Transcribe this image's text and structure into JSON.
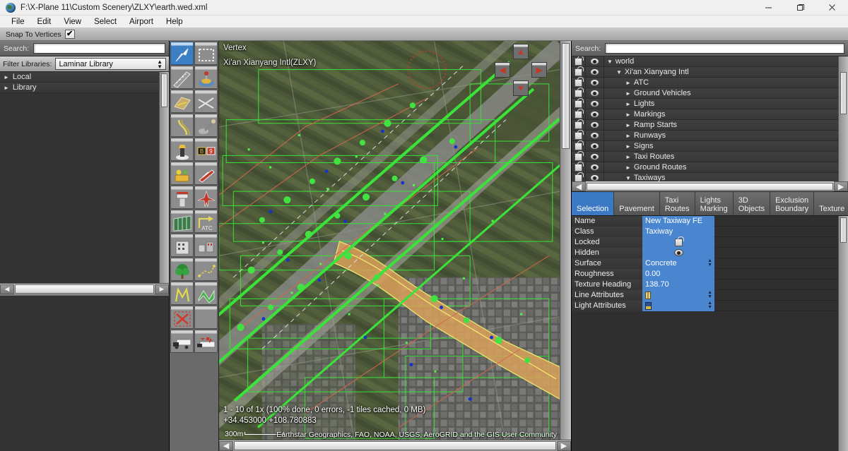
{
  "window": {
    "title": "F:\\X-Plane 11\\Custom Scenery\\ZLXY\\earth.wed.xml",
    "minimize": "—",
    "maximize": "❐",
    "close": "×"
  },
  "menubar": {
    "items": [
      "File",
      "Edit",
      "View",
      "Select",
      "Airport",
      "Help"
    ]
  },
  "toolstrip": {
    "snap_label": "Snap To Vertices",
    "snap_checked": "✔"
  },
  "left_panel": {
    "search_label": "Search:",
    "search_value": "",
    "filter_label": "Filter Libraries:",
    "filter_value": "Laminar Library",
    "tree": [
      {
        "label": "Local",
        "arrow": "►"
      },
      {
        "label": "Library",
        "arrow": "►"
      }
    ],
    "scroll_left": "◄",
    "scroll_right": "►"
  },
  "palette": {
    "tools": [
      {
        "name": "arrow-select-tool",
        "glyph": "↖",
        "selected": true
      },
      {
        "name": "marquee-select-tool",
        "glyph": "⬚",
        "selected": false
      },
      {
        "name": "runway-tool",
        "glyph": "╱",
        "selected": false
      },
      {
        "name": "helipad-tool",
        "glyph": "⊕",
        "selected": false
      },
      {
        "name": "taxiway-tool",
        "glyph": "▱",
        "selected": false
      },
      {
        "name": "sealane-tool",
        "glyph": "✕",
        "selected": false
      },
      {
        "name": "taxiline-tool",
        "glyph": "⤵",
        "selected": false
      },
      {
        "name": "hole-tool",
        "glyph": "⛏",
        "selected": false
      },
      {
        "name": "light-fixture-tool",
        "glyph": "⚙",
        "selected": false
      },
      {
        "name": "sign-tool",
        "glyph": "▭",
        "selected": false
      },
      {
        "name": "ramp-start-tool",
        "glyph": "✈",
        "selected": false
      },
      {
        "name": "windsock-tool",
        "glyph": "➤",
        "selected": false
      },
      {
        "name": "tower-viewpoint-tool",
        "glyph": "♜",
        "selected": false
      },
      {
        "name": "airplane-object-tool",
        "glyph": "✈",
        "selected": false
      },
      {
        "name": "facade-tool",
        "glyph": "▤",
        "selected": false
      },
      {
        "name": "atc-flow-tool",
        "glyph": "ATC",
        "selected": false
      },
      {
        "name": "building-tool",
        "glyph": "▦",
        "selected": false
      },
      {
        "name": "object-tool",
        "glyph": "▣",
        "selected": false
      },
      {
        "name": "forest-tool",
        "glyph": "♣",
        "selected": false
      },
      {
        "name": "line-string-tool",
        "glyph": "∴",
        "selected": false
      },
      {
        "name": "polygon-tool",
        "glyph": "ⱼ",
        "selected": false
      },
      {
        "name": "draped-polygon-tool",
        "glyph": "▰",
        "selected": false
      },
      {
        "name": "exclusion-zone-tool",
        "glyph": "✕",
        "selected": false
      },
      {
        "name": "empty-tool",
        "glyph": "",
        "selected": false
      },
      {
        "name": "truck-parking-tool",
        "glyph": "⛟",
        "selected": false
      },
      {
        "name": "truck-destination-tool",
        "glyph": "⇄",
        "selected": false
      }
    ]
  },
  "map": {
    "mode_label": "Vertex",
    "airport_label": "Xi'an Xianyang Intl(ZLXY)",
    "status_line": "1 - 10 of 1x (100% done, 0 errors, -1 tiles cached, 0 MB)",
    "coordinates": "+34.453000 +108.780883",
    "scale_label": "300m",
    "attribution": "Earthstar Geographics, FAO, NOAA, USGS, AeroGRID and the GIS User Community",
    "nav_buttons": [
      "pan-up",
      "pan-left",
      "pan-right",
      "pan-down"
    ]
  },
  "right_panel": {
    "search_label": "Search:",
    "search_value": "",
    "tree": [
      {
        "label": "world",
        "arrow": "▼",
        "indent": 0
      },
      {
        "label": "Xi'an Xianyang Intl",
        "arrow": "▼",
        "indent": 1
      },
      {
        "label": "ATC",
        "arrow": "►",
        "indent": 2
      },
      {
        "label": "Ground Vehicles",
        "arrow": "►",
        "indent": 2
      },
      {
        "label": "Lights",
        "arrow": "►",
        "indent": 2
      },
      {
        "label": "Markings",
        "arrow": "►",
        "indent": 2
      },
      {
        "label": "Ramp Starts",
        "arrow": "►",
        "indent": 2
      },
      {
        "label": "Runways",
        "arrow": "►",
        "indent": 2
      },
      {
        "label": "Signs",
        "arrow": "►",
        "indent": 2
      },
      {
        "label": "Taxi Routes",
        "arrow": "►",
        "indent": 2
      },
      {
        "label": "Ground Routes",
        "arrow": "►",
        "indent": 2
      },
      {
        "label": "Taxiways",
        "arrow": "▼",
        "indent": 2
      }
    ],
    "tabs": [
      {
        "line1": "",
        "line2": "Selection",
        "active": true
      },
      {
        "line1": "",
        "line2": "Pavement",
        "active": false
      },
      {
        "line1": "Taxi",
        "line2": "Routes",
        "active": false
      },
      {
        "line1": "Lights",
        "line2": "Marking",
        "active": false
      },
      {
        "line1": "3D",
        "line2": "Objects",
        "active": false
      },
      {
        "line1": "Exclusion",
        "line2": "Boundary",
        "active": false
      },
      {
        "line1": "",
        "line2": "Texture",
        "active": false
      }
    ],
    "properties": [
      {
        "name": "Name",
        "value": "New Taxiway FE",
        "kind": "text"
      },
      {
        "name": "Class",
        "value": "Taxiway",
        "kind": "text"
      },
      {
        "name": "Locked",
        "value": "",
        "kind": "lock-icon"
      },
      {
        "name": "Hidden",
        "value": "",
        "kind": "eye-icon"
      },
      {
        "name": "Surface",
        "value": "Concrete",
        "kind": "select"
      },
      {
        "name": "Roughness",
        "value": "0.00",
        "kind": "text"
      },
      {
        "name": "Texture Heading",
        "value": "138.70",
        "kind": "text"
      },
      {
        "name": "Line Attributes",
        "value": "",
        "kind": "line-swatch"
      },
      {
        "name": "Light Attributes",
        "value": "",
        "kind": "light-swatch"
      }
    ]
  },
  "colors": {
    "accent_blue": "#4a86cf",
    "tab_active": "#3b79c4",
    "panel_bg": "#2f2f2f",
    "overlay_green": "#3dd93d",
    "taxiway_tan": "#d9a05b"
  }
}
